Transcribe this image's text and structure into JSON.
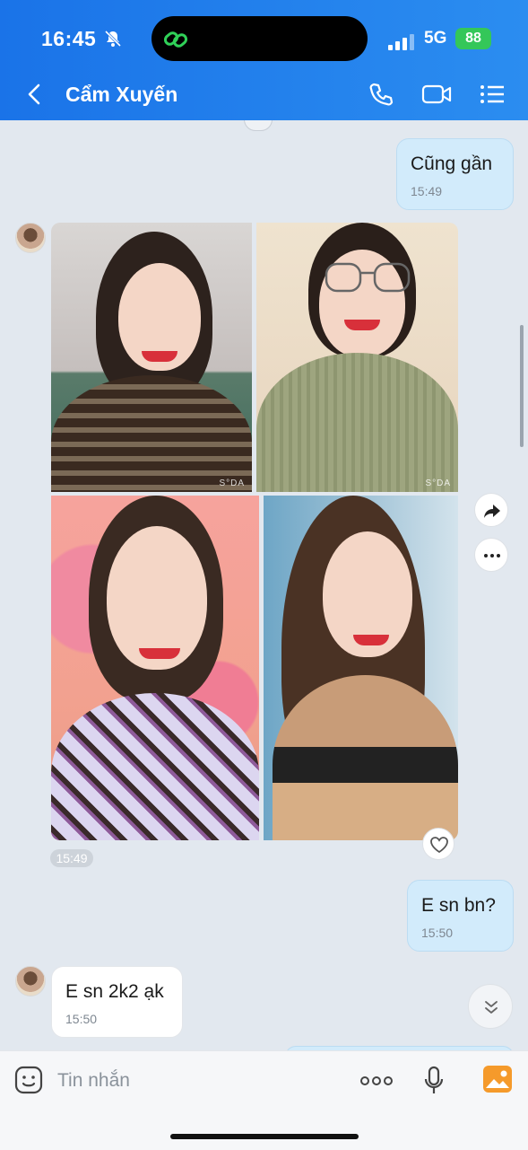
{
  "status_bar": {
    "time": "16:45",
    "network": "5G",
    "battery": "88"
  },
  "header": {
    "title": "Cẩm Xuyến",
    "accent": "#1a73e8"
  },
  "messages": [
    {
      "direction": "out",
      "text": "Cũng gần",
      "time": "15:49"
    },
    {
      "direction": "in",
      "type": "photos",
      "count": 4,
      "time": "15:49",
      "watermark": "S°DA"
    },
    {
      "direction": "out",
      "text": "E sn bn?",
      "time": "15:50"
    },
    {
      "direction": "in",
      "text": "E sn 2k2 ạk",
      "time": "15:50"
    }
  ],
  "input": {
    "placeholder": "Tin nhắn"
  },
  "icons": [
    "chevron-left-icon",
    "phone-icon",
    "video-icon",
    "list-icon",
    "forward-icon",
    "more-icon",
    "heart-icon",
    "chevron-down-icon",
    "emoji-icon",
    "ellipsis-icon",
    "mic-icon",
    "image-icon"
  ]
}
